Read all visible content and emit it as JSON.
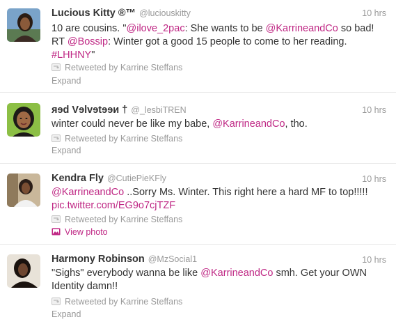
{
  "colors": {
    "link": "#bf2784",
    "muted": "#999999",
    "text": "#333333",
    "separator": "#e8e8e8"
  },
  "tweets": [
    {
      "name": "Lucious Kitty ®™",
      "handle": "@luciouskitty",
      "time": "10 hrs",
      "text": [
        {
          "t": "10 are cousins. \"",
          "link": false
        },
        {
          "t": "@ilove_2pac",
          "link": true
        },
        {
          "t": ": She wants to be ",
          "link": false
        },
        {
          "t": "@KarrineandCo",
          "link": true
        },
        {
          "t": " so bad! RT ",
          "link": false
        },
        {
          "t": "@Bossip",
          "link": true
        },
        {
          "t": ": Winter got a good 15 people to come to her reading. ",
          "link": false
        },
        {
          "t": "#LHHNY",
          "link": true
        },
        {
          "t": "\"",
          "link": false
        }
      ],
      "retweeted_by": "Retweeted by Karrine Steffans",
      "action": "Expand",
      "avatar_icon": "profile-photo"
    },
    {
      "name": "ᴙɘd Vɘlvɘtɘɘᴎ †",
      "handle": "@_lesbiTREN",
      "time": "10 hrs",
      "text": [
        {
          "t": "winter could never be like my babe, ",
          "link": false
        },
        {
          "t": "@KarrineandCo",
          "link": true
        },
        {
          "t": ", tho.",
          "link": false
        }
      ],
      "retweeted_by": "Retweeted by Karrine Steffans",
      "action": "Expand",
      "avatar_icon": "cartoon-avatar"
    },
    {
      "name": "Kendra Fly",
      "handle": "@CutiePieKFly",
      "time": "10 hrs",
      "text": [
        {
          "t": "@KarrineandCo",
          "link": true
        },
        {
          "t": " ..Sorry Ms. Winter. This right here a hard MF to top!!!!! ",
          "link": false
        },
        {
          "t": "pic.twitter.com/EG9o7cjTZF",
          "link": true
        }
      ],
      "retweeted_by": "Retweeted by Karrine Steffans",
      "action": "View photo",
      "avatar_icon": "profile-photo"
    },
    {
      "name": "Harmony Robinson",
      "handle": "@MzSocial1",
      "time": "10 hrs",
      "text": [
        {
          "t": "\"Sighs\" everybody wanna be like ",
          "link": false
        },
        {
          "t": "@KarrineandCo",
          "link": true
        },
        {
          "t": " smh. Get your OWN Identity damn!!",
          "link": false
        }
      ],
      "retweeted_by": "Retweeted by Karrine Steffans",
      "action": "Expand",
      "avatar_icon": "profile-photo"
    }
  ]
}
